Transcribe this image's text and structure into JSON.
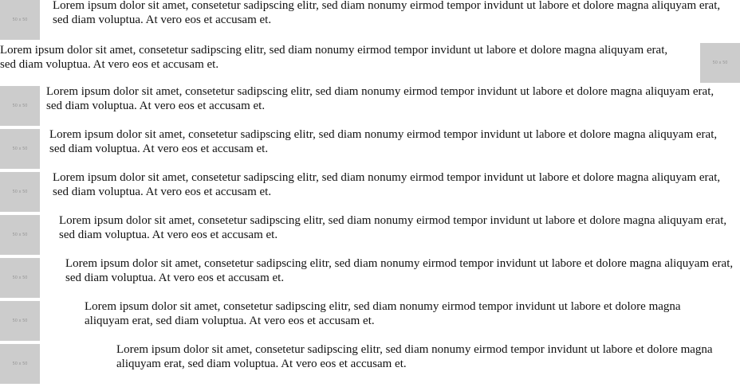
{
  "media_items": [
    {
      "image_label": "50 x 50",
      "text": "Lorem ipsum dolor sit amet, consetetur sadipscing elitr, sed diam nonumy eirmod tempor invidunt ut labore et dolore magna aliquyam erat, sed diam voluptua. At vero eos et accusam et."
    },
    {
      "image_label": "50 x 50",
      "text": "Lorem ipsum dolor sit amet, consetetur sadipscing elitr, sed diam nonumy eirmod tempor invidunt ut labore et dolore magna aliquyam erat, sed diam voluptua. At vero eos et accusam et."
    },
    {
      "image_label": "50 x 50",
      "text": "Lorem ipsum dolor sit amet, consetetur sadipscing elitr, sed diam nonumy eirmod tempor invidunt ut labore et dolore magna aliquyam erat, sed diam voluptua. At vero eos et accusam et."
    },
    {
      "image_label": "50 x 50",
      "text": "Lorem ipsum dolor sit amet, consetetur sadipscing elitr, sed diam nonumy eirmod tempor invidunt ut labore et dolore magna aliquyam erat, sed diam voluptua. At vero eos et accusam et."
    },
    {
      "image_label": "50 x 50",
      "text": "Lorem ipsum dolor sit amet, consetetur sadipscing elitr, sed diam nonumy eirmod tempor invidunt ut labore et dolore magna aliquyam erat, sed diam voluptua. At vero eos et accusam et."
    },
    {
      "image_label": "50 x 50",
      "text": "Lorem ipsum dolor sit amet, consetetur sadipscing elitr, sed diam nonumy eirmod tempor invidunt ut labore et dolore magna aliquyam erat, sed diam voluptua. At vero eos et accusam et."
    },
    {
      "image_label": "50 x 50",
      "text": "Lorem ipsum dolor sit amet, consetetur sadipscing elitr, sed diam nonumy eirmod tempor invidunt ut labore et dolore magna aliquyam erat, sed diam voluptua. At vero eos et accusam et."
    },
    {
      "image_label": "50 x 50",
      "text": "Lorem ipsum dolor sit amet, consetetur sadipscing elitr, sed diam nonumy eirmod tempor invidunt ut labore et dolore magna aliquyam erat, sed diam voluptua. At vero eos et accusam et."
    },
    {
      "image_label": "50 x 50",
      "text": "Lorem ipsum dolor sit amet, consetetur sadipscing elitr, sed diam nonumy eirmod tempor invidunt ut labore et dolore magna aliquyam erat, sed diam voluptua. At vero eos et accusam et."
    }
  ],
  "colors": {
    "placeholder_background": "#cccccc",
    "placeholder_text": "#969696",
    "body_text": "#111111",
    "page_background": "#ffffff"
  }
}
